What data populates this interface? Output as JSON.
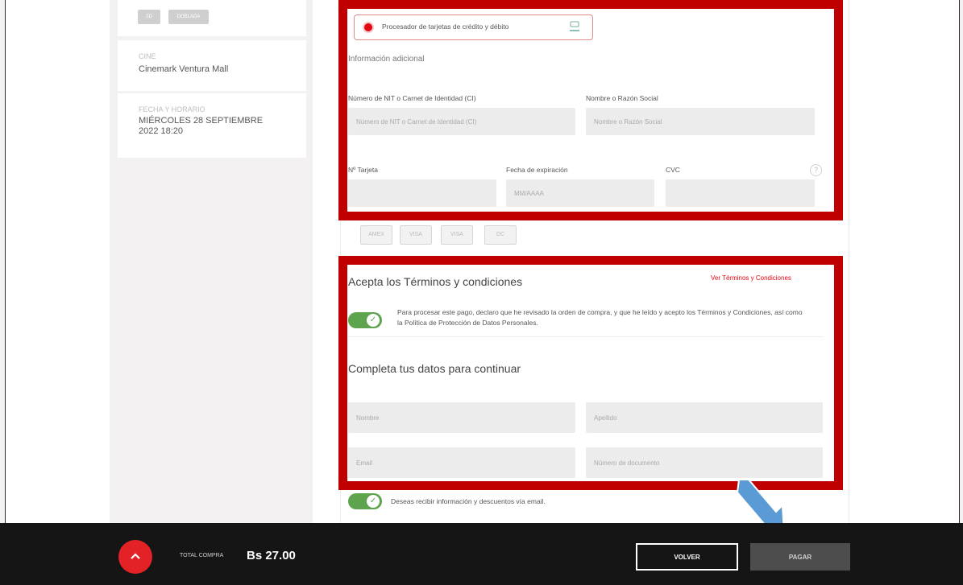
{
  "sidebar": {
    "chips": [
      "2D",
      "DOBLADA"
    ],
    "cine_label": "CINE",
    "cine_value": "Cinemark Ventura Mall",
    "fecha_label": "FECHA Y HORARIO",
    "fecha_value_line1": "MIÉRCOLES 28 SEPTIEMBRE",
    "fecha_value_line2": "2022 18:20"
  },
  "payment": {
    "option_label": "Procesador de tarjetas de crédito y débito",
    "info_title": "Información adicional",
    "nit_label": "Número de NIT o Carnet de Identidad (CI)",
    "nit_placeholder": "Número de NIT o Carnet de Identidad (CI)",
    "razon_label": "Nombre o Razón Social",
    "razon_placeholder": "Nombre o Razón Social",
    "card_number_label": "Nº Tarjeta",
    "card_number_placeholder": "",
    "expiry_label": "Fecha de expiración",
    "expiry_placeholder": "MM/AAAA",
    "cvc_label": "CVC",
    "cvc_placeholder": "",
    "help_symbol": "?",
    "card_brands": [
      "AMEX",
      "VISA",
      "VISA",
      "DC"
    ]
  },
  "terms": {
    "heading": "Acepta los Términos y condiciones",
    "link": "Ver Términos y Condiciones",
    "text": "Para procesar este pago, declaro que he revisado la orden de compra, y que he leído y acepto los Términos y Condiciones, así como la Política de Protección de Datos Personales.",
    "accepted": true
  },
  "contact": {
    "heading": "Completa tus datos para continuar",
    "nombre_placeholder": "Nombre",
    "apellido_placeholder": "Apellido",
    "email_placeholder": "Email",
    "documento_placeholder": "Número de documento",
    "newsletter_label": "Deseas recibir información y descuentos vía email."
  },
  "footer": {
    "total_label": "TOTAL COMPRA",
    "total_value": "Bs 27.00",
    "volver_label": "VOLVER",
    "pagar_label": "PAGAR"
  },
  "colors": {
    "highlight": "#c00000",
    "accent": "#e30613",
    "toggle_on": "#5ea34e",
    "arrow": "#5b9bd5"
  }
}
